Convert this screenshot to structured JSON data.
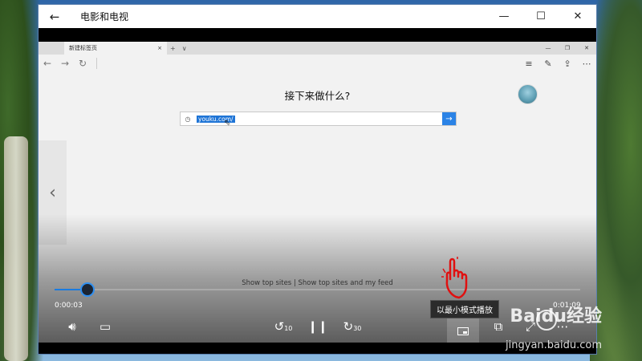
{
  "window": {
    "title": "电影和电视",
    "back_icon": "←",
    "minimize_icon": "—",
    "maximize_icon": "☐",
    "close_icon": "✕"
  },
  "browser": {
    "tab_label": "新建标签页",
    "tab_close": "×",
    "new_tab": "+",
    "tab_list": "∨",
    "win_min": "—",
    "win_max": "❐",
    "win_close": "✕",
    "nav_back": "←",
    "nav_forward": "→",
    "nav_refresh": "↻",
    "prompt": "接下来做什么?",
    "search_value": "youku.com/",
    "go_icon": "→",
    "topsites": "Show top sites | Show top sites and my feed"
  },
  "player": {
    "current_time": "0:00:03",
    "total_time": "0:01:09",
    "progress": 0.063,
    "skip_back_label": "10",
    "skip_forward_label": "30",
    "tooltip": "以最小模式播放"
  },
  "watermark": {
    "brand": "Baidu经验",
    "url": "jingyan.baidu.com"
  }
}
